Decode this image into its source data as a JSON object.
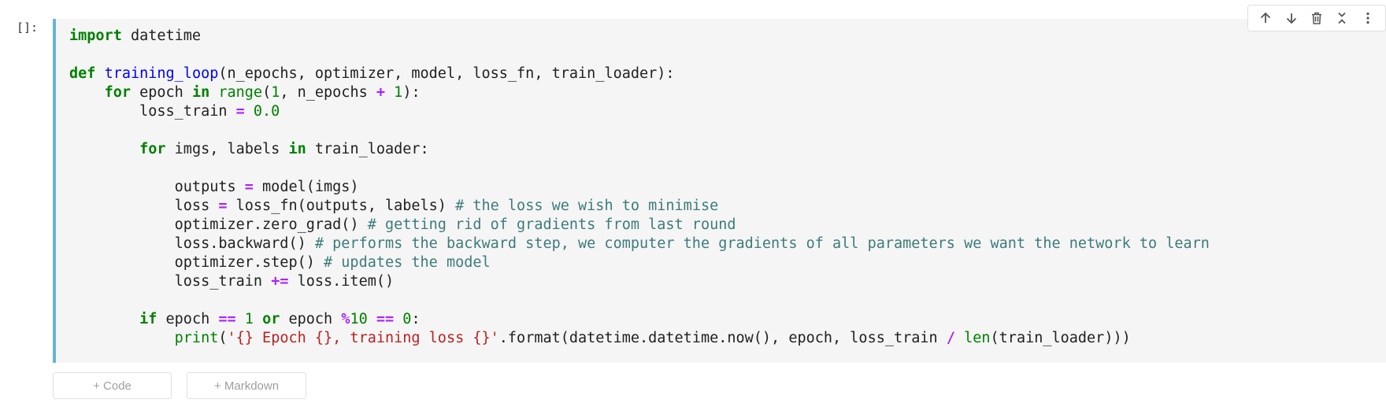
{
  "cell": {
    "execution_prompt": "[]:",
    "code_lines": [
      "import datetime",
      "",
      "def training_loop(n_epochs, optimizer, model, loss_fn, train_loader):",
      "    for epoch in range(1, n_epochs + 1):",
      "        loss_train = 0.0",
      "",
      "        for imgs, labels in train_loader:",
      "",
      "            outputs = model(imgs)",
      "            loss = loss_fn(outputs, labels) # the loss we wish to minimise",
      "            optimizer.zero_grad() # getting rid of gradients from last round",
      "            loss.backward() # performs the backward step, we computer the gradients of all parameters we want the network to learn",
      "            optimizer.step() # updates the model",
      "            loss_train += loss.item()",
      "",
      "        if epoch == 1 or epoch %10 == 0:",
      "            print('{} Epoch {}, training loss {}'.format(datetime.datetime.now(), epoch, loss_train / len(train_loader)))"
    ]
  },
  "cell_toolbar": {
    "buttons": [
      {
        "icon": "arrow-up-icon",
        "action": "move-up"
      },
      {
        "icon": "arrow-down-icon",
        "action": "move-down"
      },
      {
        "icon": "trash-icon",
        "action": "delete"
      },
      {
        "icon": "collapse-icon",
        "action": "collapse"
      },
      {
        "icon": "more-vertical-icon",
        "action": "more"
      }
    ]
  },
  "add_cell": {
    "code_label": "+ Code",
    "markdown_label": "+ Markdown"
  },
  "colors": {
    "accent_border": "#64b5d6",
    "keyword": "#008000",
    "function_name": "#0000ff",
    "operator": "#aa22ff",
    "string": "#ba2121",
    "comment": "#3d7b7b",
    "cell_background": "#f5f5f5"
  }
}
